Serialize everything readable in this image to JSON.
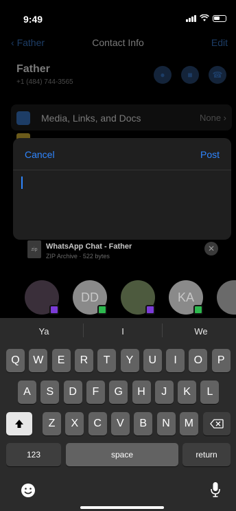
{
  "status": {
    "time": "9:49"
  },
  "contact": {
    "back_label": "Father",
    "title": "Contact Info",
    "edit_label": "Edit",
    "name": "Father",
    "phone": "+1 (484) 744-3565",
    "media_label": "Media, Links, and Docs",
    "media_value": "None"
  },
  "modal": {
    "cancel_label": "Cancel",
    "post_label": "Post",
    "text": ""
  },
  "attachment": {
    "icon_label": "zip",
    "name": "WhatsApp Chat - Father",
    "meta": "ZIP Archive · 522 bytes"
  },
  "avatars": [
    {
      "initials": "",
      "color": "#3a2f3a",
      "badge": "messenger"
    },
    {
      "initials": "DD",
      "color": "#8a8a8a",
      "badge": "messages"
    },
    {
      "initials": "",
      "color": "#4d5a3e",
      "badge": "messenger"
    },
    {
      "initials": "KA",
      "color": "#8a8a8a",
      "badge": "messages"
    },
    {
      "initials": "",
      "color": "#6a6a6a",
      "badge": ""
    }
  ],
  "keyboard": {
    "suggestions": [
      "Ya",
      "I",
      "We"
    ],
    "row1": [
      "Q",
      "W",
      "E",
      "R",
      "T",
      "Y",
      "U",
      "I",
      "O",
      "P"
    ],
    "row2": [
      "A",
      "S",
      "D",
      "F",
      "G",
      "H",
      "J",
      "K",
      "L"
    ],
    "row3": [
      "Z",
      "X",
      "C",
      "V",
      "B",
      "N",
      "M"
    ],
    "numbers_label": "123",
    "space_label": "space",
    "return_label": "return"
  },
  "colors": {
    "accent": "#2f86ff"
  }
}
